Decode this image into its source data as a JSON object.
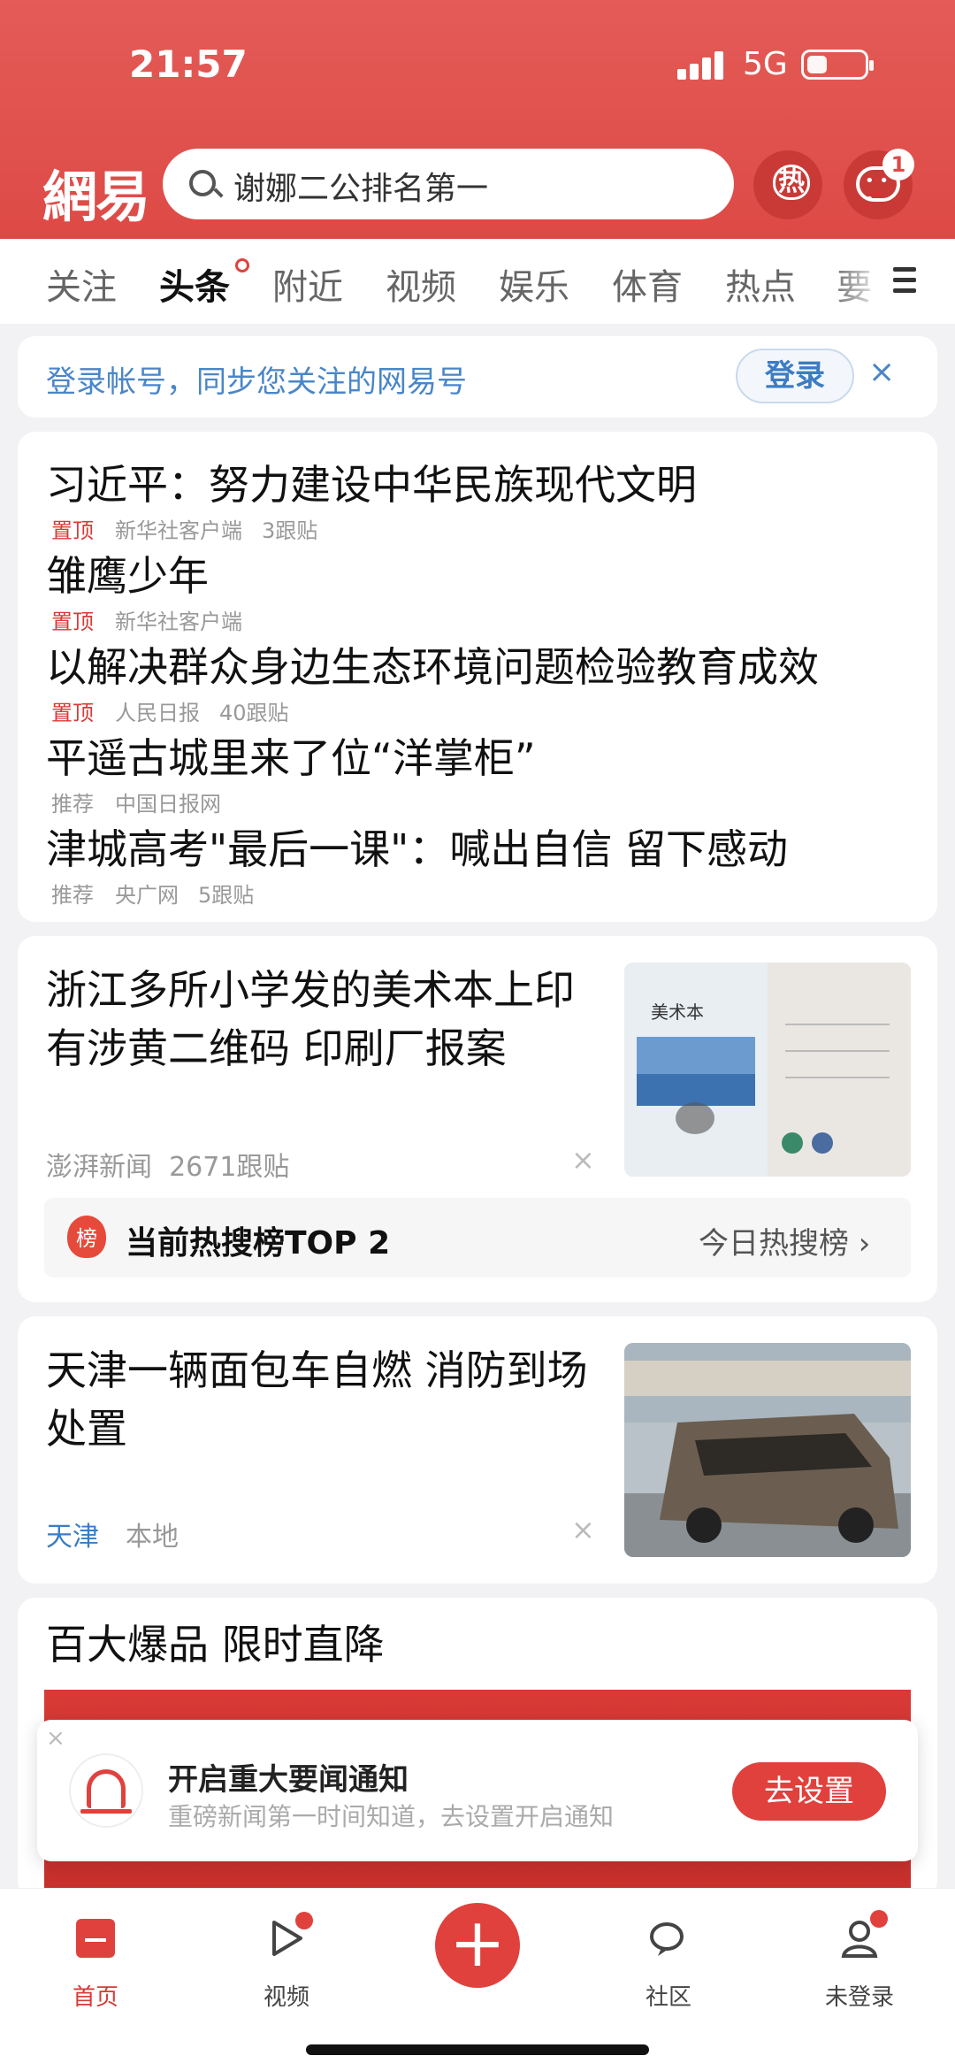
{
  "status": {
    "time": "21:57",
    "network": "5G"
  },
  "header": {
    "logo": "網易",
    "search_placeholder": "谢娜二公排名第一",
    "hot_label": "热",
    "msg_badge": "1"
  },
  "tabs": [
    "关注",
    "头条",
    "附近",
    "视频",
    "娱乐",
    "体育",
    "热点",
    "要"
  ],
  "login_banner": {
    "text": "登录帐号，同步您关注的网易号",
    "button": "登录",
    "close": "×"
  },
  "top_news": [
    {
      "title": "习近平：努力建设中华民族现代文明",
      "tag": "置顶",
      "source": "新华社客户端",
      "comments": "3跟贴"
    },
    {
      "title": "雏鹰少年",
      "tag": "置顶",
      "source": "新华社客户端",
      "comments": ""
    },
    {
      "title": "以解决群众身边生态环境问题检验教育成效",
      "tag": "置顶",
      "source": "人民日报",
      "comments": "40跟贴"
    },
    {
      "title": "平遥古城里来了位“洋掌柜”",
      "tag": "推荐",
      "source": "中国日报网",
      "comments": ""
    },
    {
      "title": "津城高考\"最后一课\"：喊出自信 留下感动",
      "tag": "推荐",
      "source": "央广网",
      "comments": "5跟贴"
    }
  ],
  "article1": {
    "title": "浙江多所小学发的美术本上印有涉黄二维码 印刷厂报案",
    "source": "澎湃新闻",
    "comments": "2671跟贴",
    "hot_badge": "榜",
    "hot_text": "当前热搜榜TOP 2",
    "hot_link": "今日热搜榜 ›",
    "thumb_title": "美术本"
  },
  "article2": {
    "title": "天津一辆面包车自燃 消防到场处置",
    "location": "天津",
    "category": "本地"
  },
  "article3": {
    "title": "百大爆品 限时直降"
  },
  "notification": {
    "title": "开启重大要闻通知",
    "subtitle": "重磅新闻第一时间知道，去设置开启通知",
    "button": "去设置"
  },
  "bottom_nav": [
    {
      "label": "首页"
    },
    {
      "label": "视频"
    },
    {
      "label": ""
    },
    {
      "label": "社区"
    },
    {
      "label": "未登录"
    }
  ],
  "colors": {
    "brand_red": "#dd4a46",
    "link_blue": "#3c7cc3"
  }
}
